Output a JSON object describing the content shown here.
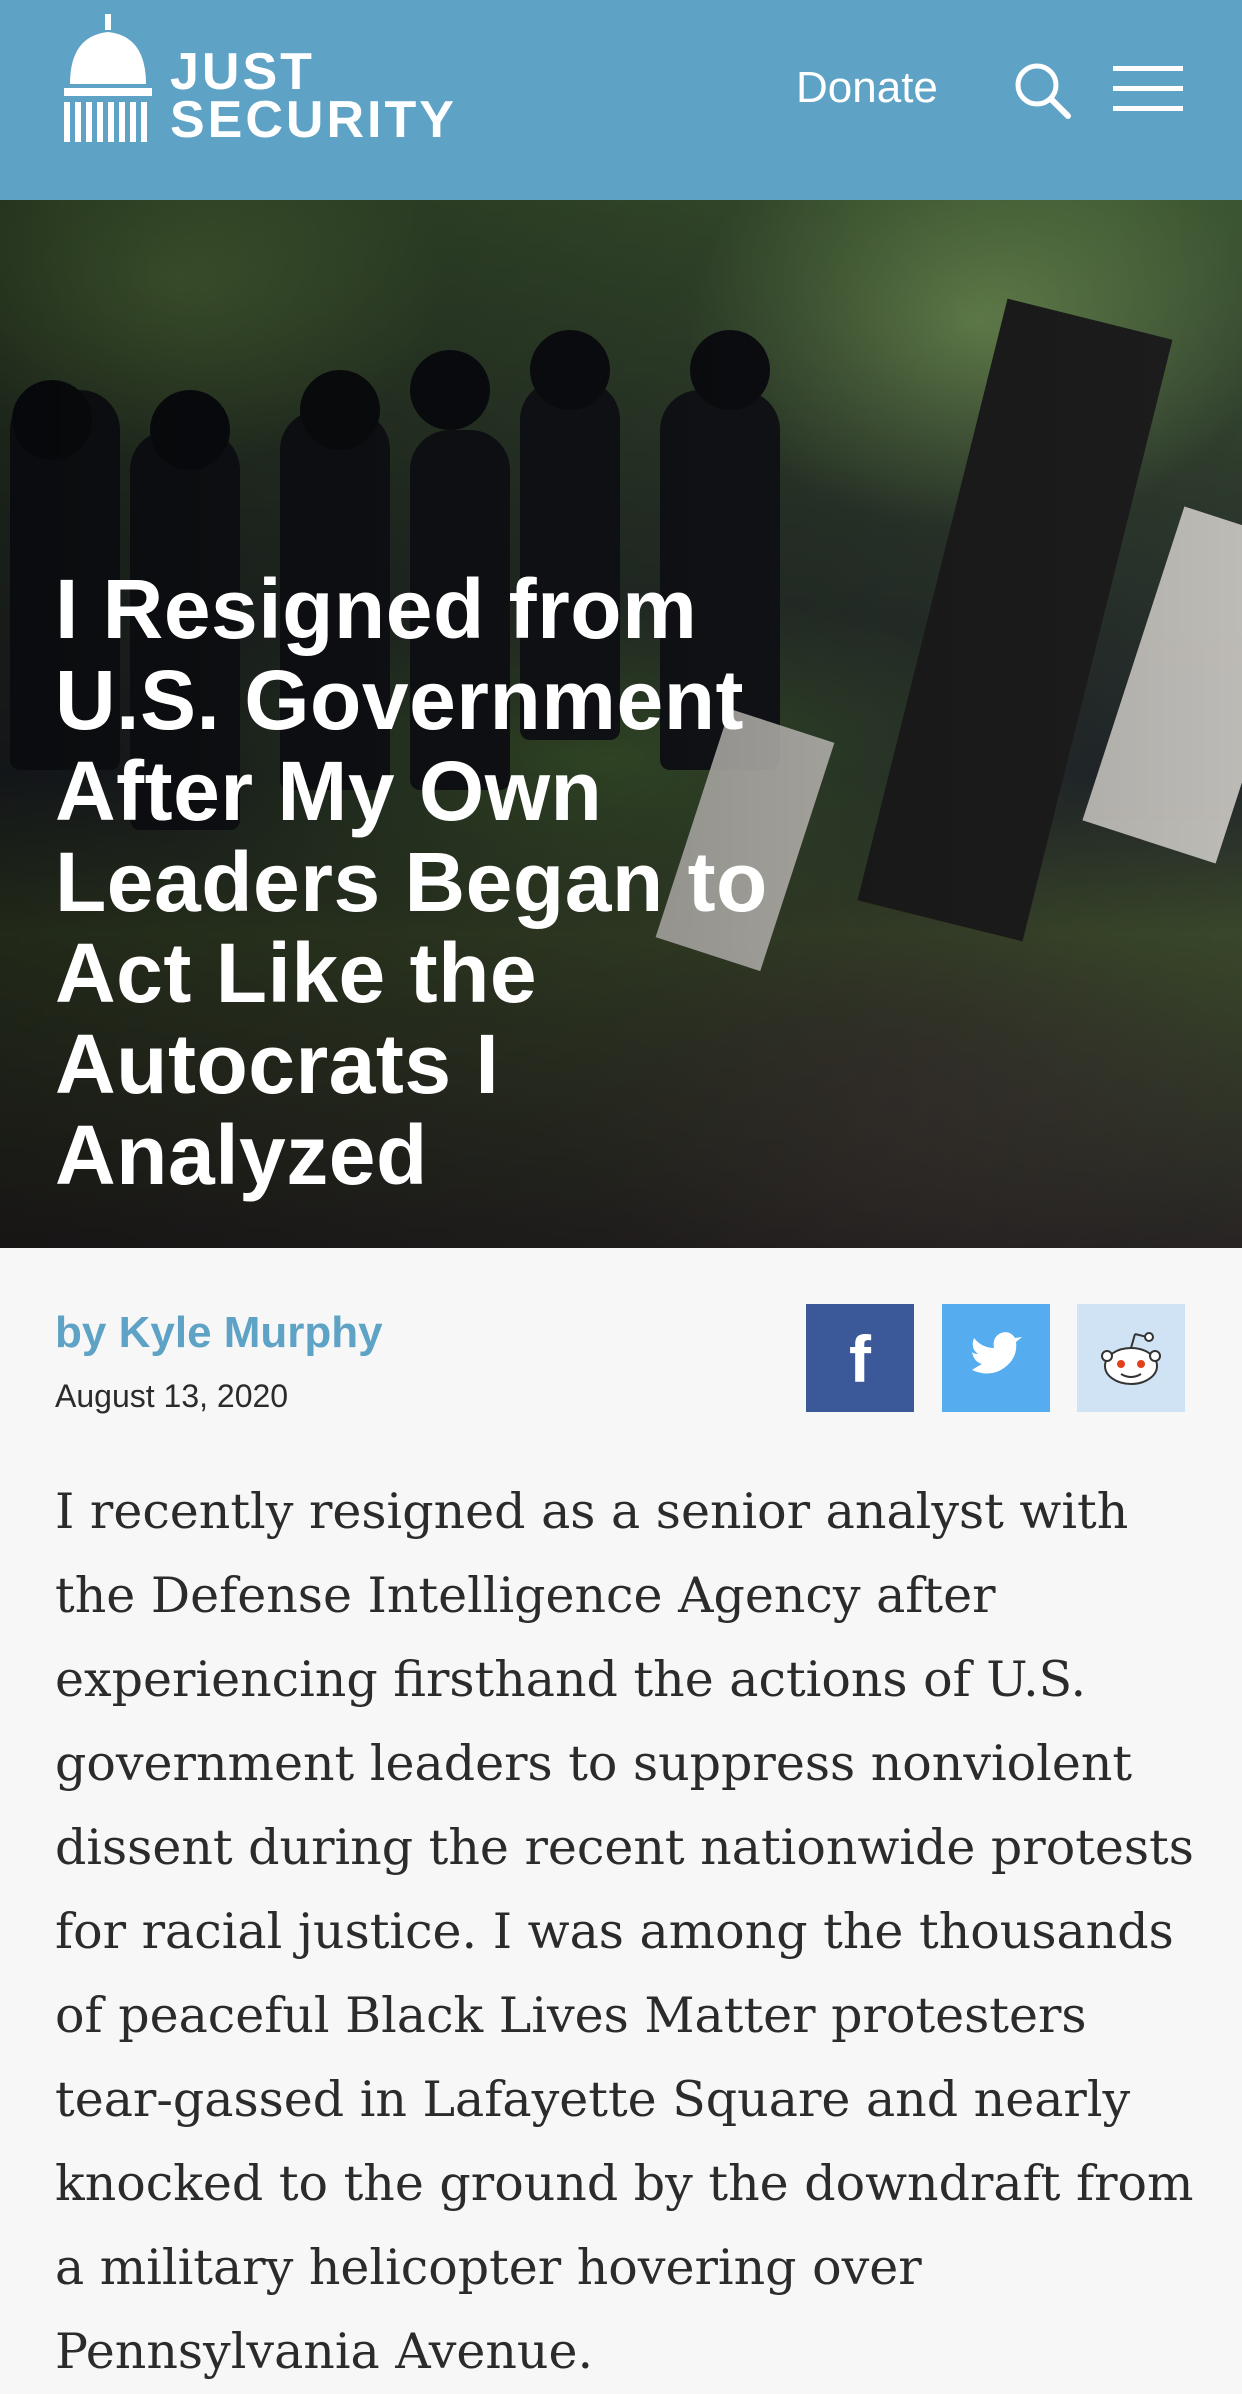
{
  "header": {
    "logo_line1": "JUST",
    "logo_line2": "SECURITY",
    "donate_label": "Donate",
    "icons": [
      "capitol-icon",
      "search-icon",
      "hamburger-menu-icon"
    ]
  },
  "hero": {
    "headline": "I Resigned from U.S. Government After My Own Leaders Began to Act Like the Autocrats I Analyzed"
  },
  "article": {
    "byline_prefix": "by",
    "author": "Kyle Murphy",
    "date": "August 13, 2020",
    "share": {
      "facebook_icon": "f",
      "twitter_icon": "twitter-bird-icon",
      "reddit_icon": "reddit-alien-icon"
    },
    "paragraph": "I recently resigned as a senior analyst with the Defense Intelligence Agency after experiencing firsthand the actions of U.S. government leaders to suppress nonviolent dissent during the recent nationwide protests for racial justice. I was among the thousands of peaceful Black Lives Matter protesters tear-gassed in Lafayette Square and nearly knocked to the ground by the downdraft from a military helicopter hovering over Pennsylvania Avenue."
  },
  "colors": {
    "header_bg": "#5ea3c6",
    "page_bg": "#f7f7f7",
    "link": "#5ea3c6",
    "facebook": "#3b5998",
    "twitter": "#55acee",
    "reddit_bg": "#cfe3f4"
  }
}
